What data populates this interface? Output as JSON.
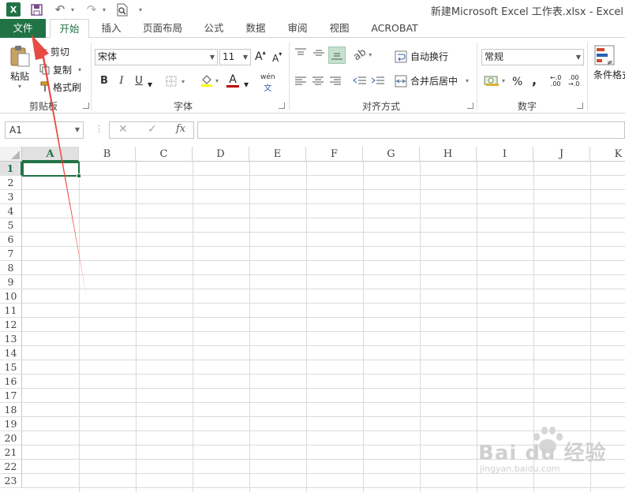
{
  "app": {
    "title": "新建Microsoft Excel 工作表.xlsx - Excel",
    "logo_text": "X",
    "brand_color": "#217346"
  },
  "qat": {
    "save_icon": "save-icon",
    "undo_icon": "undo-icon",
    "redo_icon": "redo-icon",
    "preview_icon": "print-preview-icon"
  },
  "tabs": [
    {
      "label": "文件"
    },
    {
      "label": "开始"
    },
    {
      "label": "插入"
    },
    {
      "label": "页面布局"
    },
    {
      "label": "公式"
    },
    {
      "label": "数据"
    },
    {
      "label": "审阅"
    },
    {
      "label": "视图"
    },
    {
      "label": "ACROBAT"
    }
  ],
  "ribbon": {
    "clipboard": {
      "paste_label": "粘贴",
      "cut_label": "剪切",
      "copy_label": "复制",
      "format_painter_label": "格式刷",
      "group_label": "剪贴板"
    },
    "font": {
      "font_name": "宋体",
      "font_size": "11",
      "grow_label": "A",
      "shrink_label": "A",
      "bold_label": "B",
      "italic_label": "I",
      "underline_label": "U",
      "font_color_label": "A",
      "phonetic_label": "wén",
      "group_label": "字体",
      "highlight_color": "#ffff00",
      "font_color": "#c00000"
    },
    "alignment": {
      "wrap_label": "自动换行",
      "merge_label": "合并后居中",
      "group_label": "对齐方式"
    },
    "number": {
      "format": "常规",
      "percent_label": "%",
      "comma_label": ",",
      "group_label": "数字"
    },
    "styles": {
      "conditional_label": "条件格式"
    }
  },
  "formula_bar": {
    "name_box": "A1",
    "cancel_label": "✕",
    "enter_label": "✓",
    "fx_label": "fx",
    "formula": ""
  },
  "grid": {
    "columns": [
      "A",
      "B",
      "C",
      "D",
      "E",
      "F",
      "G",
      "H",
      "I",
      "J",
      "K"
    ],
    "rows": [
      "1",
      "2",
      "3",
      "4",
      "5",
      "6",
      "7",
      "8",
      "9",
      "10",
      "11",
      "12",
      "13",
      "14",
      "15",
      "16",
      "17",
      "18",
      "19",
      "20",
      "21",
      "22",
      "23"
    ],
    "selected_cell": "A1"
  },
  "watermark": {
    "main": "Bai du 经验",
    "sub": "jingyan.baidu.com"
  },
  "annotation": {
    "arrow_color": "#e8403a"
  }
}
